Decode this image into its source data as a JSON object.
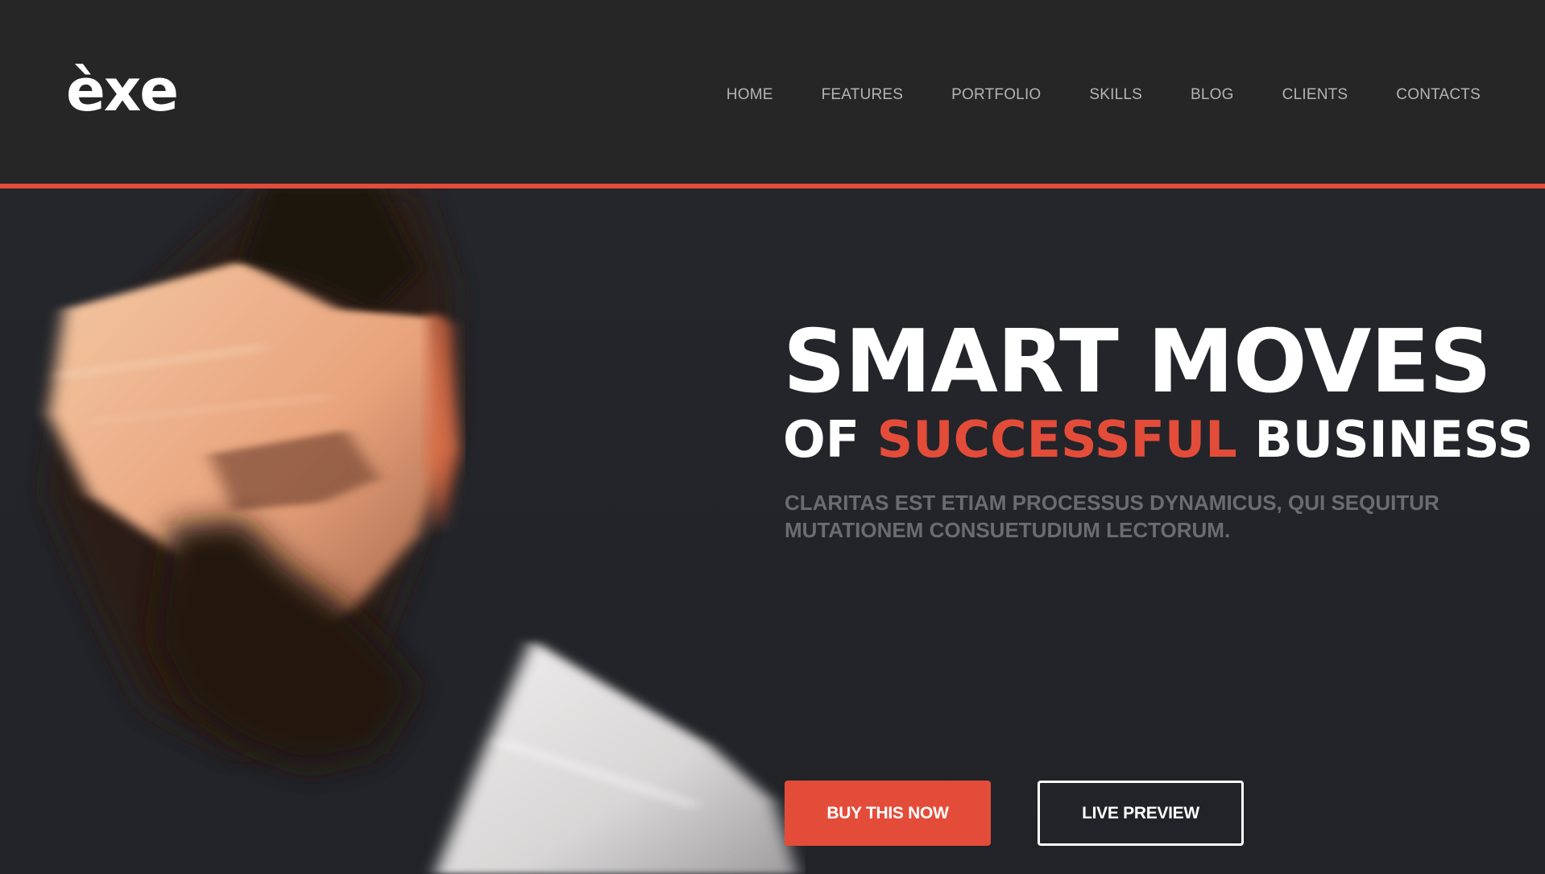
{
  "header": {
    "logo_text": "èxe",
    "nav": [
      "HOME",
      "FEATURES",
      "PORTFOLIO",
      "SKILLS",
      "BLOG",
      "CLIENTS",
      "CONTACTS"
    ]
  },
  "hero": {
    "title_line1": "SMART MOVES",
    "title_line2_prefix": "OF",
    "title_line2_accent": "SUCCESSFUL",
    "title_line2_suffix": "BUSINESS",
    "subtitle": "CLARITAS EST ETIAM PROCESSUS DYNAMICUS, QUI SEQUITUR MUTATIONEM CONSUETUDIUM LECTORUM.",
    "buy_button": "BUY THIS NOW",
    "preview_button": "LIVE PREVIEW"
  },
  "colors": {
    "accent": "#e44c3a",
    "header_bg": "#262627",
    "hero_bg": "#23252a",
    "nav_text": "#b4b4b4",
    "subtitle_text": "#6b6c70"
  }
}
